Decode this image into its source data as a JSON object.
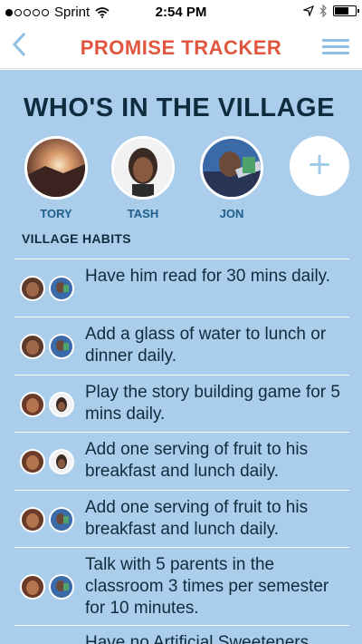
{
  "status_bar": {
    "carrier": "Sprint",
    "time": "2:54 PM",
    "signal_filled": 1,
    "signal_total": 5
  },
  "nav": {
    "brand": "PROMISE TRACKER",
    "back_icon": "chevron-left-icon",
    "menu_icon": "hamburger-icon"
  },
  "village": {
    "title": "WHO'S IN THE VILLAGE",
    "members": [
      {
        "name": "TORY",
        "avatar": "sunset-photo"
      },
      {
        "name": "TASH",
        "avatar": "portrait-photo"
      },
      {
        "name": "JON",
        "avatar": "portrait-photo"
      }
    ],
    "add_label": "+"
  },
  "habits": {
    "header": "VILLAGE HABITS",
    "items": [
      {
        "text": "Have him read for 30 mins daily."
      },
      {
        "text": "Add a glass of water to lunch or dinner daily."
      },
      {
        "text": "Play the story building game for 5 mins daily."
      },
      {
        "text": "Add one serving of fruit to his breakfast and lunch daily."
      },
      {
        "text": "Add one serving of fruit to his breakfast and lunch daily."
      },
      {
        "text": "Talk with 5 parents in the classroom 3 times per semester for 10 minutes."
      },
      {
        "text": "Have no Artificial Sweeteners"
      }
    ]
  },
  "colors": {
    "accent": "#e0563e",
    "nav_icon": "#8fbfe3",
    "background": "#a9cdea",
    "title": "#0f2c3f",
    "member_name": "#1f5f8e"
  }
}
